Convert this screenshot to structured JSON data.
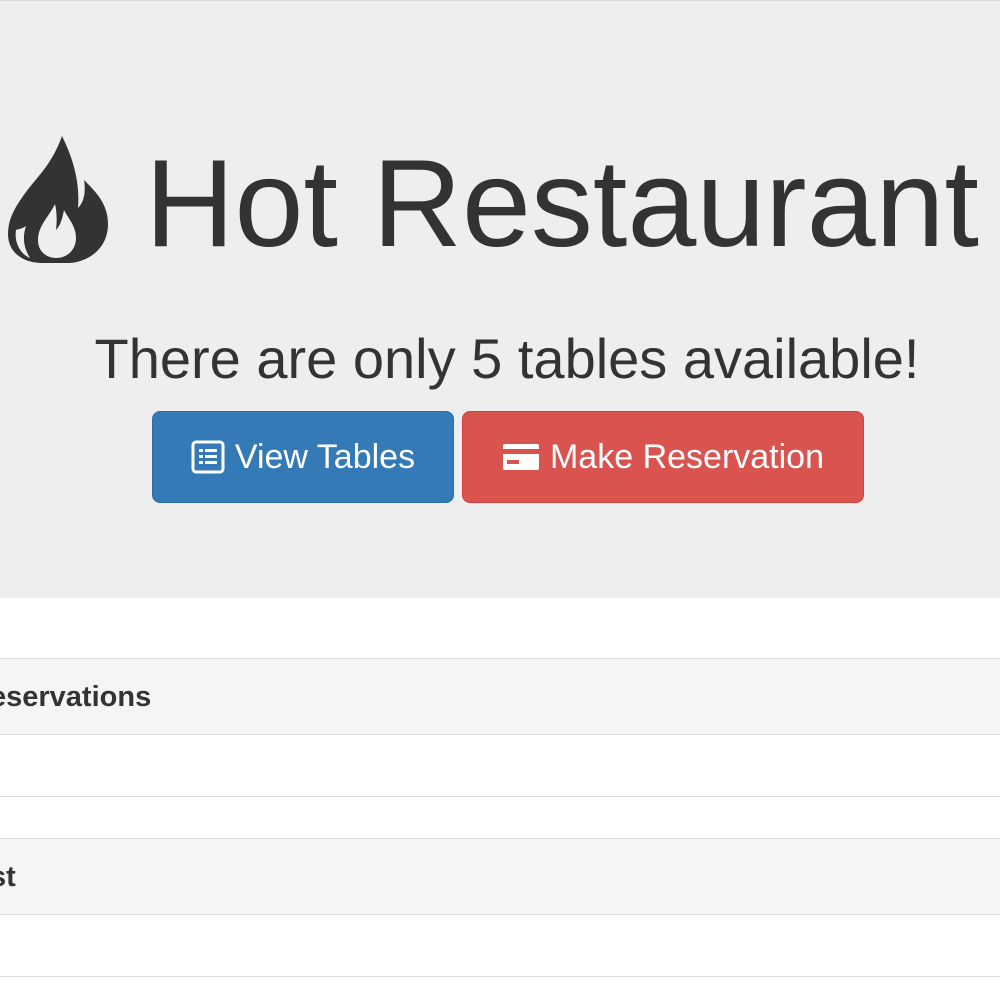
{
  "jumbotron": {
    "title": "Hot Restaurant",
    "title_icon": "fire-icon",
    "subtitle": "There are only 5 tables available!",
    "buttons": [
      {
        "label": "View Tables",
        "icon": "list-alt-icon",
        "color": "#337ab7"
      },
      {
        "label": "Make Reservation",
        "icon": "credit-card-icon",
        "color": "#d9534f"
      }
    ]
  },
  "panels": [
    {
      "heading": "eservations"
    },
    {
      "heading": "st"
    }
  ]
}
